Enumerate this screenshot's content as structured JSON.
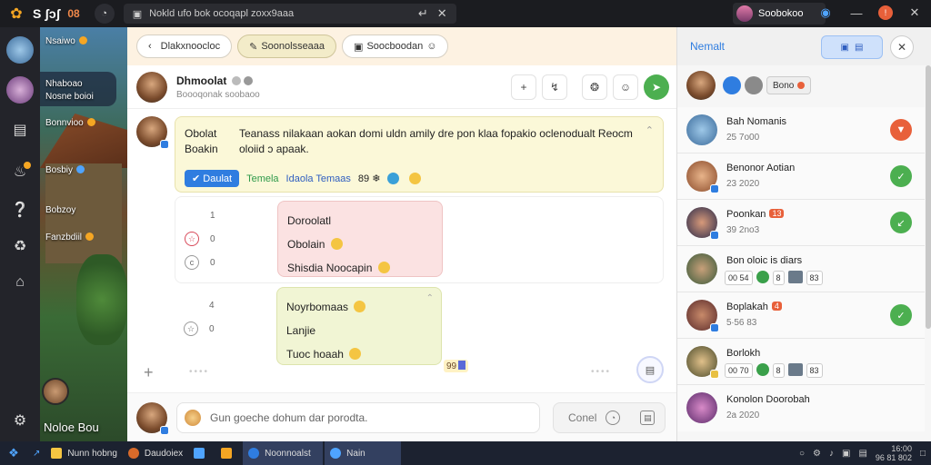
{
  "topbar": {
    "app_title": "S ʃɔʃ",
    "app_badge": "08",
    "tab_title": "Nokld ufo bok ocoqapl zoxx9aaa",
    "tab_pin": "↵",
    "tab_close": "✕",
    "profile_name": "Soobokoo"
  },
  "rail": {
    "items": [
      {
        "icon": "user-avatar-icon"
      },
      {
        "icon": "active-user-avatar-icon"
      },
      {
        "icon": "log-in-icon"
      },
      {
        "icon": "notification-bell-icon"
      },
      {
        "icon": "question-icon"
      },
      {
        "icon": "globe-icon"
      },
      {
        "icon": "home-icon"
      },
      {
        "icon": "settings-icon"
      }
    ]
  },
  "scene": {
    "labels": [
      {
        "text": "Nsaiwo",
        "dot": "#f5a623"
      },
      {
        "text": "Nhaboao",
        "dot": ""
      },
      {
        "text": "Nosne boioi",
        "dot": ""
      },
      {
        "text": "Bonnvioo",
        "dot": "#f5a623"
      },
      {
        "text": "Bosbiy",
        "dot": "#4fa4ff"
      },
      {
        "text": "Bobzoy",
        "dot": ""
      },
      {
        "text": "Fanzbdiil",
        "dot": "#f5a623"
      }
    ],
    "footer": "Noloe  Bou"
  },
  "chat": {
    "tabs": [
      "Dlakxnoocloc",
      "Soonolsseaaa",
      "Soocboodan"
    ],
    "header": {
      "name": "Dhmoolat",
      "subtitle": "Boooqonak soobaoo"
    },
    "message": {
      "sender_lines": [
        "Obolat",
        "Boakin"
      ],
      "text": "Teanass nilakaan aokan domi uldn amily dre pon klaa fopakio oclenodualt Reocm oloiid ɔ apaak.",
      "reactions": {
        "pill": "Daulat",
        "green_tag": "Temela",
        "blue_tag": "Idaola Temaas",
        "count": "89"
      }
    },
    "thread1": {
      "side": [
        {
          "num": "1",
          "icon": ""
        },
        {
          "num": "0",
          "icon": "☆"
        },
        {
          "num": "0",
          "icon": "c"
        }
      ],
      "bubble_lines": [
        "Doroolatl",
        "Obolain",
        "Shisdia  Noocapin"
      ]
    },
    "thread2": {
      "side": [
        {
          "num": "4",
          "icon": ""
        },
        {
          "num": "0",
          "icon": "☆"
        }
      ],
      "bubble_lines": [
        "Noyrbomaas",
        "Lanjie",
        "Tuoc hoaah"
      ],
      "badge": "99"
    },
    "composer": {
      "placeholder": "Gun goeche dohum dar porodta.",
      "cancel_label": "Conel"
    }
  },
  "right_panel": {
    "title": "Nemalt",
    "top_chip": "Bono",
    "rows": [
      {
        "name": "Bah Nomanis",
        "sub": "25 7o00",
        "tag": "",
        "action": "red",
        "chips": []
      },
      {
        "name": "Benonor Aotian",
        "sub": "23 2020",
        "tag": "",
        "action": "green",
        "chips": []
      },
      {
        "name": "Poonkan",
        "sub": "39 2no3",
        "tag": "13",
        "action": "green",
        "chips": []
      },
      {
        "name": "Bon oloic is diars",
        "sub": "",
        "tag": "",
        "action": "",
        "chips": [
          "00 54",
          "8",
          "83"
        ]
      },
      {
        "name": "Boplakah",
        "sub": "5∙56 83",
        "tag": "4",
        "action": "green",
        "chips": []
      },
      {
        "name": "Borlokh",
        "sub": "",
        "tag": "",
        "action": "",
        "chips": [
          "00 70",
          "8",
          "83"
        ]
      },
      {
        "name": "Konolon  Doorobah",
        "sub": "2a 2020",
        "tag": "",
        "action": "",
        "chips": []
      }
    ]
  },
  "taskbar": {
    "items": [
      {
        "label": "Nunn hobng",
        "color": "#f5c542"
      },
      {
        "label": "Daudoiex",
        "color": "#d86a2a"
      },
      {
        "label": "",
        "color": "#4fa4ff"
      },
      {
        "label": "",
        "color": "#f5a623"
      },
      {
        "label": "Noonnoalst",
        "color": "#2f7de0"
      },
      {
        "label": "Nain",
        "color": "#4fa4ff"
      }
    ],
    "clock_time": "16:00",
    "clock_date": "96 81 802"
  }
}
